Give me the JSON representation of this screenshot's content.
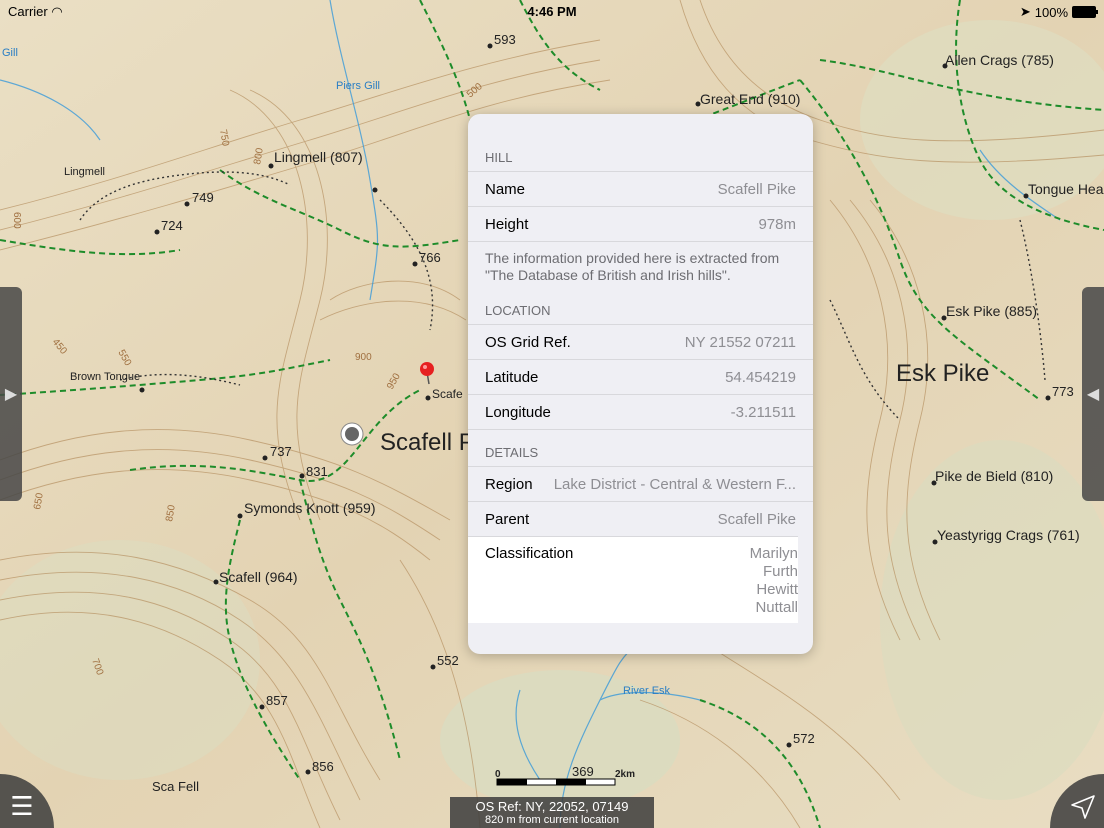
{
  "status_bar": {
    "carrier": "Carrier",
    "time": "4:46 PM",
    "battery": "100%"
  },
  "map_labels": {
    "piers_gill": "Piers Gill",
    "gill": "Gill",
    "great_end": "Great End (910)",
    "allen_crags": "Allen Crags (785)",
    "tongue_head": "Tongue Hea",
    "lingmell_807": "Lingmell (807)",
    "lingmell": "Lingmell",
    "h749": "749",
    "h724": "724",
    "h766": "766",
    "h593": "593",
    "brown_tongue": "Brown Tongue",
    "h737": "737",
    "h831": "831",
    "symonds_knott": "Symonds Knott (959)",
    "scafell": "Scafell (964)",
    "scafell_pike_big": "Scafell P",
    "scafe_small": "Scafe",
    "esk_pike_big": "Esk Pike",
    "esk_pike": "Esk Pike (885)",
    "h773": "773",
    "pike_de_bield": "Pike de Bield (810)",
    "yeastyrigg": "Yeastyrigg Crags (761)",
    "h552": "552",
    "river_esk": "River Esk",
    "h857": "857",
    "h856": "856",
    "h572": "572",
    "h369": "369",
    "sca_fell": "Sca Fell",
    "c900": "900",
    "c950": "950",
    "c550": "550",
    "c500": "500",
    "c600": "600",
    "c650": "650",
    "c700": "700",
    "c750": "750",
    "c800": "800",
    "c850": "850",
    "c450": "450",
    "scale_0": "0",
    "scale_2km": "2km"
  },
  "popover": {
    "hill_header": "HILL",
    "name_label": "Name",
    "name_value": "Scafell Pike",
    "height_label": "Height",
    "height_value": "978m",
    "note": "The information provided here is extracted from \"The Database of British and Irish hills\".",
    "location_header": "LOCATION",
    "grid_label": "OS Grid Ref.",
    "grid_value": "NY 21552 07211",
    "lat_label": "Latitude",
    "lat_value": "54.454219",
    "lon_label": "Longitude",
    "lon_value": "-3.211511",
    "details_header": "DETAILS",
    "region_label": "Region",
    "region_value": "Lake District - Central & Western F...",
    "parent_label": "Parent",
    "parent_value": "Scafell Pike",
    "class_label": "Classification",
    "classes": [
      "Marilyn",
      "Furth",
      "Hewitt",
      "Nuttall"
    ]
  },
  "bottom_info": {
    "os_ref": "OS Ref: NY, 22052, 07149",
    "distance": "820 m from current location"
  },
  "icons": {
    "menu": "menu-icon",
    "locate": "location-arrow-icon",
    "left_tab": "chevron-right-icon",
    "right_tab": "chevron-left-icon"
  },
  "colors": {
    "footpath": "#1e8c2a",
    "contour": "#b08a5a",
    "water": "#3a9ad9",
    "pin": "#e62020"
  }
}
